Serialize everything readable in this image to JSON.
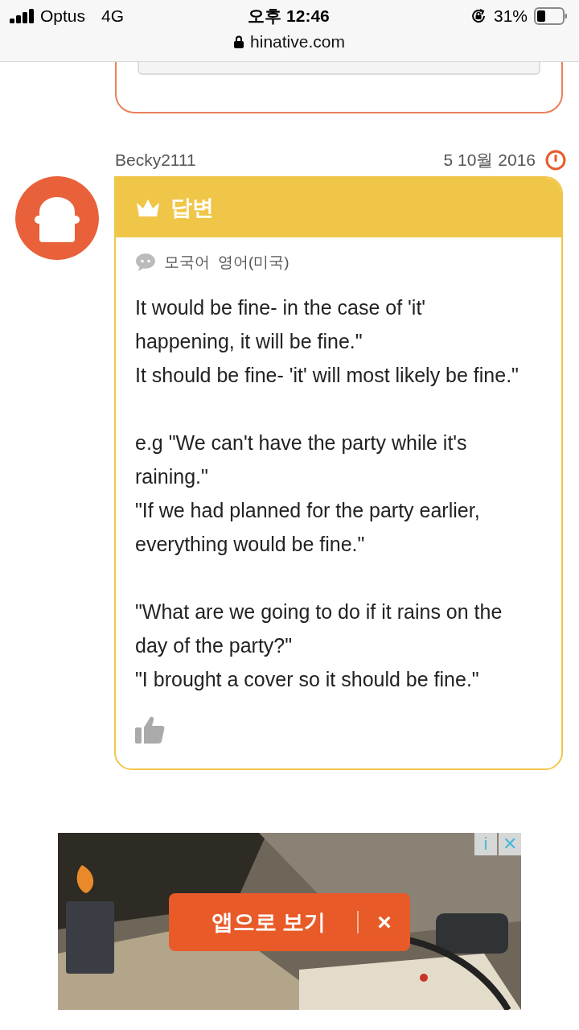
{
  "status_bar": {
    "carrier": "Optus",
    "network": "4G",
    "time": "오후 12:46",
    "battery": "31%"
  },
  "address_bar": {
    "url": "hinative.com"
  },
  "answer": {
    "author": "Becky2111",
    "date": "5 10월 2016",
    "header": "답변",
    "native_label": "모국어",
    "native_language": "영어(미국)",
    "paragraphs": [
      [
        "It would be fine- in the case of 'it' happening, it will be fine.\"",
        "It should be fine- 'it' will most likely be fine.\""
      ],
      [
        "e.g \"We can't have the party while it's raining.\"",
        "\"If we had planned for the party earlier, everything would be fine.\""
      ],
      [
        "\"What are we going to do if it rains on the day of the party?\"",
        "\"I brought a cover so it should be fine.\""
      ]
    ]
  },
  "ad": {
    "info": "i",
    "close": "✕"
  },
  "app_banner": {
    "label": "앱으로 보기",
    "close": "×"
  }
}
